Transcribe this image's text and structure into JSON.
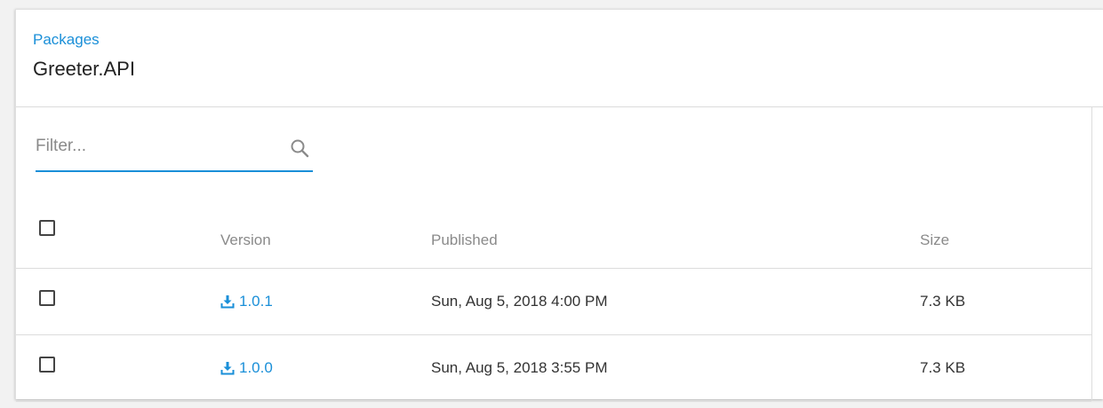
{
  "header": {
    "breadcrumb": "Packages",
    "title": "Greeter.API"
  },
  "filter": {
    "placeholder": "Filter...",
    "value": "",
    "icon": "search-icon"
  },
  "table": {
    "columns": [
      "Version",
      "Published",
      "Size"
    ],
    "rows": [
      {
        "version": "1.0.1",
        "published": "Sun, Aug 5, 2018 4:00 PM",
        "size": "7.3 KB",
        "icon": "download-icon"
      },
      {
        "version": "1.0.0",
        "published": "Sun, Aug 5, 2018 3:55 PM",
        "size": "7.3 KB",
        "icon": "download-icon"
      }
    ]
  },
  "colors": {
    "accent": "#1a8fd8",
    "text": "#333333",
    "muted": "#8a8a8a",
    "divider": "#dcdcdc"
  }
}
